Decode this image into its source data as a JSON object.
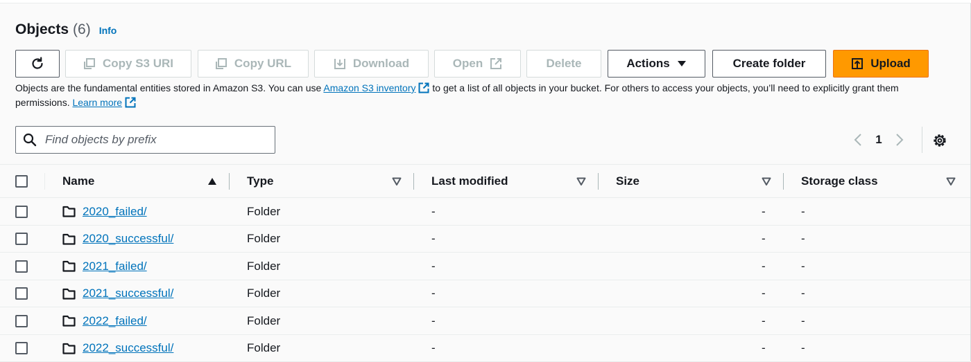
{
  "header": {
    "title": "Objects",
    "count": "(6)",
    "info": "Info"
  },
  "toolbar": {
    "refresh_icon": "refresh-icon",
    "copy_s3_uri": "Copy S3 URI",
    "copy_url": "Copy URL",
    "download": "Download",
    "open": "Open",
    "delete": "Delete",
    "actions": "Actions",
    "create_folder": "Create folder",
    "upload": "Upload"
  },
  "description": {
    "part1": "Objects are the fundamental entities stored in Amazon S3. You can use ",
    "inventory_link": "Amazon S3 inventory",
    "part2": " to get a list of all objects in your bucket. For others to access your objects, you’ll need to explicitly grant them permissions. ",
    "learn_more": "Learn more"
  },
  "search": {
    "placeholder": "Find objects by prefix",
    "value": ""
  },
  "pagination": {
    "current_page": "1"
  },
  "table": {
    "columns": {
      "name": "Name",
      "type": "Type",
      "last_modified": "Last modified",
      "size": "Size",
      "storage_class": "Storage class"
    },
    "rows": [
      {
        "name": "2020_failed/",
        "type": "Folder",
        "last_modified": "-",
        "size": "-",
        "storage_class": "-"
      },
      {
        "name": "2020_successful/",
        "type": "Folder",
        "last_modified": "-",
        "size": "-",
        "storage_class": "-"
      },
      {
        "name": "2021_failed/",
        "type": "Folder",
        "last_modified": "-",
        "size": "-",
        "storage_class": "-"
      },
      {
        "name": "2021_successful/",
        "type": "Folder",
        "last_modified": "-",
        "size": "-",
        "storage_class": "-"
      },
      {
        "name": "2022_failed/",
        "type": "Folder",
        "last_modified": "-",
        "size": "-",
        "storage_class": "-"
      },
      {
        "name": "2022_successful/",
        "type": "Folder",
        "last_modified": "-",
        "size": "-",
        "storage_class": "-"
      }
    ]
  },
  "colors": {
    "link": "#0073bb",
    "primary": "#ff9900",
    "text": "#16191f",
    "disabled": "#aab7b8"
  }
}
